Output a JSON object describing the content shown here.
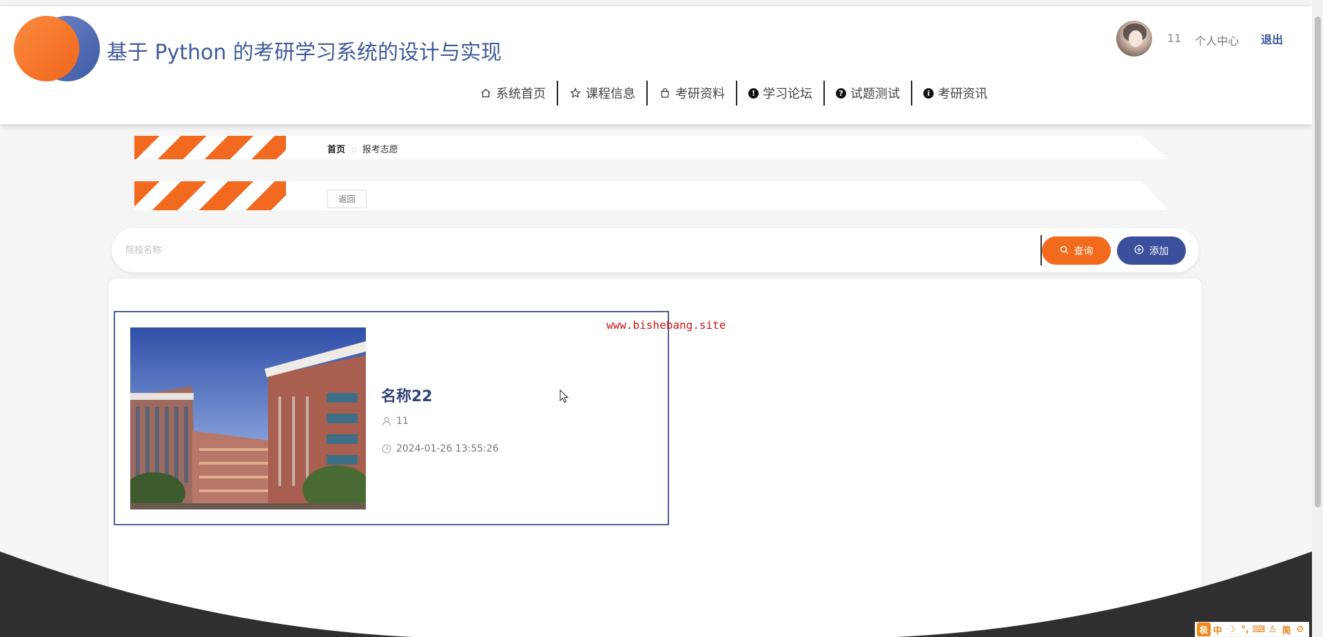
{
  "site": {
    "title": "基于 Python 的考研学习系统的设计与实现"
  },
  "user": {
    "name": "11",
    "center_label": "个人中心",
    "logout_label": "退出"
  },
  "nav": {
    "items": [
      {
        "label": "系统首页",
        "icon": "home-icon"
      },
      {
        "label": "课程信息",
        "icon": "star-icon"
      },
      {
        "label": "考研资料",
        "icon": "bag-icon"
      },
      {
        "label": "学习论坛",
        "icon": "exclamation-circle-icon"
      },
      {
        "label": "试题测试",
        "icon": "question-circle-icon"
      },
      {
        "label": "考研资讯",
        "icon": "info-circle-icon"
      }
    ]
  },
  "breadcrumb": {
    "home": "首页",
    "separator": "::",
    "current": "报考志愿"
  },
  "back_label": "返回",
  "search": {
    "placeholder": "院校名称",
    "value": "",
    "query_label": "查询",
    "add_label": "添加"
  },
  "items": [
    {
      "name": "名称22",
      "user": "11",
      "time": "2024-01-26 13:55:26"
    }
  ],
  "watermark": "www.bishebang.site",
  "colors": {
    "accent_orange": "#f26a1b",
    "accent_blue": "#3b4f9c",
    "title_blue": "#3f5a9b"
  },
  "ime": {
    "logo": "极",
    "lang": "中",
    "mode": "简"
  }
}
